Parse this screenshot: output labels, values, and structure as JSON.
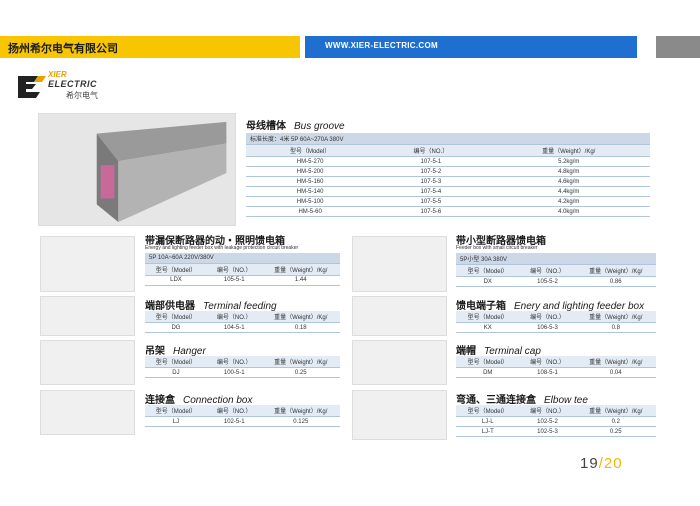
{
  "header": {
    "company": "扬州希尔电气有限公司",
    "website": "WWW.XIER-ELECTRIC.COM"
  },
  "logo": {
    "brand_top": "XIER",
    "brand": "ELECTRIC",
    "brand_cn": "希尔电气"
  },
  "bus_groove": {
    "title": "母线槽体",
    "title_en": "Bus groove",
    "spec": "标准长度：4米  5P  60A~270A  380V",
    "headers": [
      "型号（Model）",
      "编号（NO.）",
      "重量（Weight）/Kg/"
    ],
    "rows": [
      [
        "HM-5-270",
        "107-5-1",
        "5.2kg/m"
      ],
      [
        "HM-5-200",
        "107-5-2",
        "4.8kg/m"
      ],
      [
        "HM-5-160",
        "107-5-3",
        "4.6kg/m"
      ],
      [
        "HM-5-140",
        "107-5-4",
        "4.4kg/m"
      ],
      [
        "HM-5-100",
        "107-5-5",
        "4.2kg/m"
      ],
      [
        "HM-5-60",
        "107-5-6",
        "4.0kg/m"
      ]
    ]
  },
  "leakage_box": {
    "title": "带漏保断路器的动・照明馈电箱",
    "subtitle": "Energy and lighting feeder box with leakage protection circuit breaker",
    "spec": "5P  10A~60A  220V/380V",
    "headers": [
      "型号（Model）",
      "编号（NO.）",
      "重量（Weight）/Kg/"
    ],
    "rows": [
      [
        "LDX",
        "105-5-1",
        "1.44"
      ]
    ]
  },
  "mcb_box": {
    "title": "带小型断路器馈电箱",
    "subtitle": "Feeder box with small circuit breaker",
    "spec": "5P小型  30A  380V",
    "headers": [
      "型号（Model）",
      "编号（NO.）",
      "重量（Weight）/Kg/"
    ],
    "rows": [
      [
        "DX",
        "105-5-2",
        "0.86"
      ]
    ]
  },
  "terminal_feeding": {
    "title": "端部供电器",
    "title_en": "Terminal feeding",
    "headers": [
      "型号（Model）",
      "编号（NO.）",
      "重量（Weight）/Kg/"
    ],
    "rows": [
      [
        "DG",
        "104-5-1",
        "0.18"
      ]
    ]
  },
  "terminal_box": {
    "title": "馈电端子箱",
    "title_en": "Enery and lighting feeder box",
    "headers": [
      "型号（Model）",
      "编号（NO.）",
      "重量（Weight）/Kg/"
    ],
    "rows": [
      [
        "KX",
        "106-5-3",
        "0.8"
      ]
    ]
  },
  "hanger": {
    "title": "吊架",
    "title_en": "Hanger",
    "headers": [
      "型号（Model）",
      "编号（NO.）",
      "重量（Weight）/Kg/"
    ],
    "rows": [
      [
        "DJ",
        "100-5-1",
        "0.25"
      ]
    ]
  },
  "terminal_cap": {
    "title": "端帽",
    "title_en": "Terminal cap",
    "headers": [
      "型号（Model）",
      "编号（NO.）",
      "重量（Weight）/Kg/"
    ],
    "rows": [
      [
        "DM",
        "108-5-1",
        "0.04"
      ]
    ]
  },
  "connection_box": {
    "title": "连接盒",
    "title_en": "Connection box",
    "headers": [
      "型号（Model）",
      "编号（NO.）",
      "重量（Weight）/Kg/"
    ],
    "rows": [
      [
        "LJ",
        "102-5-1",
        "0.125"
      ]
    ]
  },
  "elbow_tee": {
    "title": "弯通、三通连接盒",
    "title_en": "Elbow tee",
    "headers": [
      "型号（Model）",
      "编号（NO.）",
      "重量（Weight）/Kg/"
    ],
    "rows": [
      [
        "LJ-L",
        "102-5-2",
        "0.2"
      ],
      [
        "LJ-T",
        "102-5-3",
        "0.25"
      ]
    ]
  },
  "page": {
    "current": "19",
    "sep": "/",
    "total": "20"
  }
}
